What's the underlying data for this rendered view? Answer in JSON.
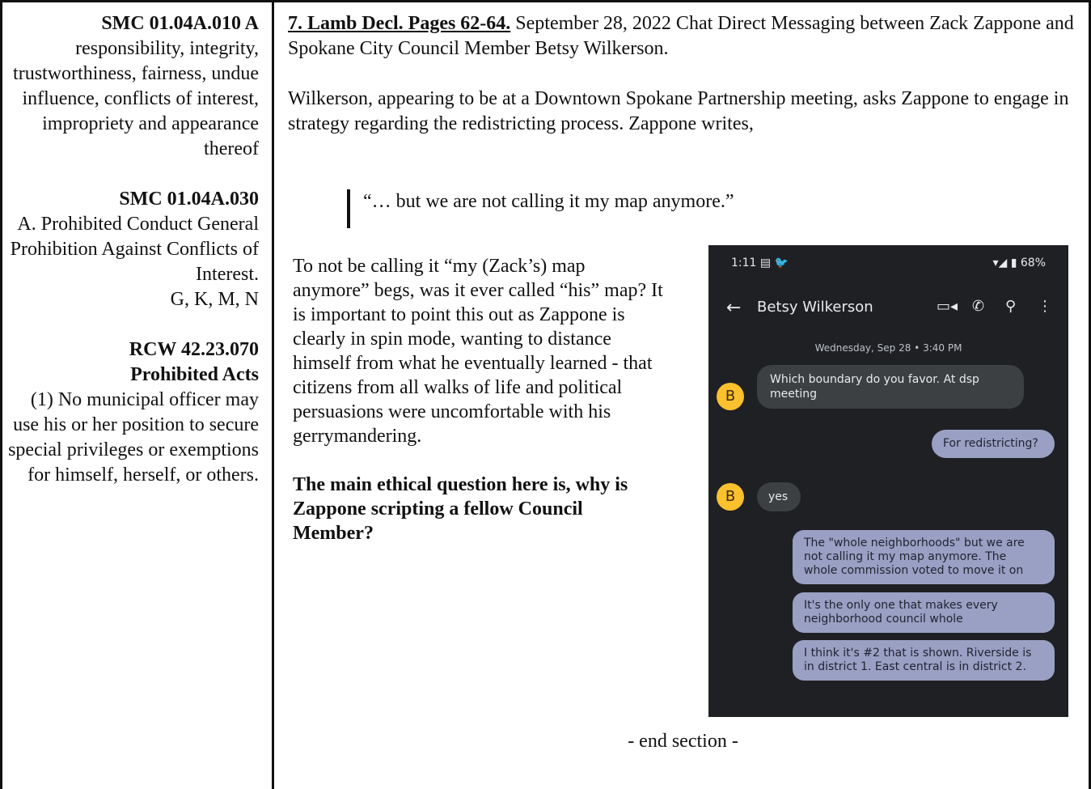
{
  "left": {
    "b1_title": "SMC 01.04A.010 A",
    "b1_text": "responsibility, integrity, trustworthiness, fairness, undue influence, conflicts of interest, impropriety and appearance thereof",
    "b2_title": "SMC 01.04A.030",
    "b2_text": "A. Prohibited Conduct General Prohibition Against Conflicts of Interest.",
    "b2_sub": "G, K, M, N",
    "b3_title": "RCW 42.23.070",
    "b3_title2": "Prohibited Acts",
    "b3_text": "(1) No municipal officer may use his or her position to secure special privileges or exemptions for himself, herself, or others."
  },
  "main": {
    "heading": "7. Lamb Decl. Pages 62-64.",
    "intro": " September 28, 2022 Chat Direct Messaging between Zack Zappone and Spokane City Council Member Betsy Wilkerson.",
    "para2": "Wilkerson, appearing to be at a Downtown Spokane Partnership meeting, asks Zappone to engage in strategy regarding the redistricting process.  Zappone writes,",
    "quote": "“… but we are not calling it my map anymore.”",
    "para3": "To not be calling it “my (Zack’s) map anymore” begs, was it ever called “his” map?  It is important to point this out as Zappone is clearly in spin mode, wanting to distance himself from what he eventually learned - that citizens from all walks of life and political persuasions were uncomfortable with his gerrymandering.",
    "question": "The main ethical question here is, why is Zappone scripting a fellow Council Member?",
    "end": "- end section -"
  },
  "phone": {
    "time": "1:11",
    "status_icons": "▤ 🐦",
    "battery": "68%",
    "contact": "Betsy Wilkerson",
    "date": "Wednesday, Sep 28 • 3:40 PM",
    "avatar_letter": "B",
    "messages": [
      {
        "dir": "in",
        "text": "Which boundary do you favor. At dsp meeting"
      },
      {
        "dir": "out",
        "text": "For redistricting?"
      },
      {
        "dir": "in",
        "text": "yes"
      },
      {
        "dir": "out",
        "text": "The \"whole neighborhoods\" but we are not calling it my map anymore. The whole commission voted to move it on"
      },
      {
        "dir": "out",
        "text": "It's the only one that makes every neighborhood council whole"
      },
      {
        "dir": "out",
        "text": "I think it's #2 that is shown. Riverside is in district 1. East central is in district 2."
      }
    ],
    "icons": [
      "back-arrow-icon",
      "video-icon",
      "phone-icon",
      "search-icon",
      "more-icon",
      "wifi-icon",
      "signal-icon",
      "battery-icon"
    ]
  }
}
